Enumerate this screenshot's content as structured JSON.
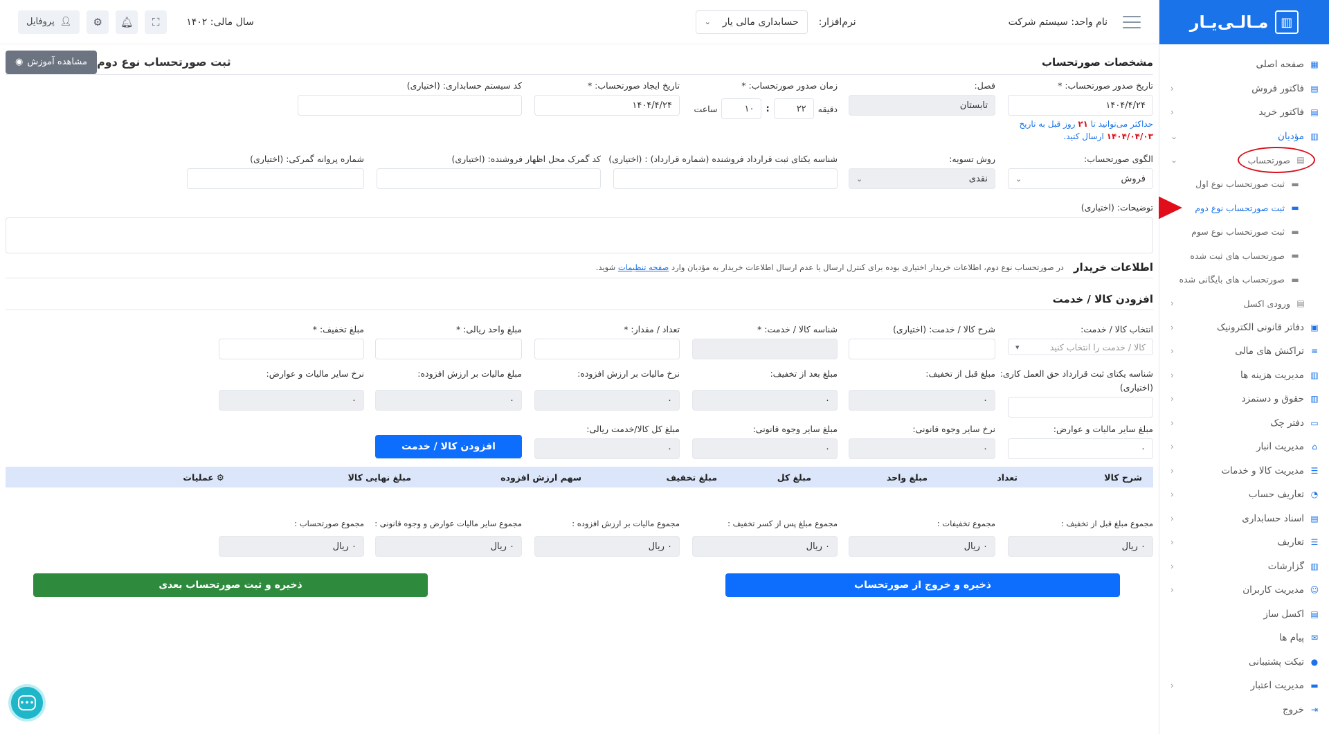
{
  "topbar": {
    "unit_label": "نام واحد: سیستم شرکت",
    "software_label": "نرم‌افزار:",
    "software_value": "حسابداری مالی یار",
    "fiscal_year": "سال مالی: ۱۴۰۲",
    "profile": "پروفایل"
  },
  "logo": {
    "text": "مـالـی‌یـار"
  },
  "sidebar": {
    "items": [
      {
        "label": "صفحه اصلی",
        "icon": "grid-icon"
      },
      {
        "label": "فاکتور فروش",
        "icon": "doc-icon"
      },
      {
        "label": "فاکتور خرید",
        "icon": "doc-icon"
      },
      {
        "label": "مؤدیان",
        "icon": "chart-icon"
      },
      {
        "label": "صورتحساب",
        "icon": "doc-icon"
      },
      {
        "label": "ثبت صورتحساب نوع اول",
        "icon": "card-icon"
      },
      {
        "label": "ثبت صورتحساب نوع دوم",
        "icon": "card-icon"
      },
      {
        "label": "ثبت صورتحساب نوع سوم",
        "icon": "card-icon"
      },
      {
        "label": "صورتحساب های ثبت شده",
        "icon": "card-icon"
      },
      {
        "label": "صورتحساب های بایگانی شده",
        "icon": "card-icon"
      },
      {
        "label": "ورودی اکسل",
        "icon": "doc-icon"
      },
      {
        "label": "دفاتر قانونی الکترونیک",
        "icon": "book-icon"
      },
      {
        "label": "تراکنش های مالی",
        "icon": "stack-icon"
      },
      {
        "label": "مدیریت هزینه ها",
        "icon": "chart-icon"
      },
      {
        "label": "حقوق و دستمزد",
        "icon": "chart-icon"
      },
      {
        "label": "دفتر چک",
        "icon": "money-icon"
      },
      {
        "label": "مدیریت انبار",
        "icon": "warehouse-icon"
      },
      {
        "label": "مدیریت کالا و خدمات",
        "icon": "list-icon"
      },
      {
        "label": "تعاریف حساب",
        "icon": "pie-icon"
      },
      {
        "label": "اسناد حسابداری",
        "icon": "doc-icon"
      },
      {
        "label": "تعاریف",
        "icon": "list-icon"
      },
      {
        "label": "گزارشات",
        "icon": "chart-icon"
      },
      {
        "label": "مدیریت کاربران",
        "icon": "users-icon"
      },
      {
        "label": "اکسل ساز",
        "icon": "doc-icon"
      },
      {
        "label": "پیام ها",
        "icon": "mail-icon"
      },
      {
        "label": "تیکت پشتیبانی",
        "icon": "chat-icon"
      },
      {
        "label": "مدیریت اعتبار",
        "icon": "card-icon"
      },
      {
        "label": "خروج",
        "icon": "exit-icon"
      }
    ]
  },
  "header": {
    "section_title": "مشخصات صورتحساب",
    "page_title": "ثبت صورتحساب نوع دوم",
    "tutorial_button": "مشاهده آموزش"
  },
  "form1": {
    "issue_date_label": "تاریخ صدور صورتحساب: *",
    "issue_date_value": "۱۴۰۴/۴/۲۴",
    "season_label": "فصل:",
    "season_value": "تابستان",
    "issue_time_label": "زمان صدور صورتحساب: *",
    "minute_label": "دقیقه",
    "minute_value": "۲۲",
    "hour_label": "ساعت",
    "hour_value": "۱۰",
    "create_date_label": "تاریخ ایجاد صورتحساب: *",
    "create_date_value": "۱۴۰۴/۴/۲۴",
    "acc_code_label": "کد سیستم حسابداری: (اختیاری)",
    "hint_line1_a": "حداکثر می‌توانید تا",
    "hint_days": "۲۱",
    "hint_line1_b": "روز قبل به تاریخ",
    "hint_date": "۱۴۰۴/۰۴/۰۳",
    "hint_line2": "ارسال کنید."
  },
  "form2": {
    "pattern_label": "الگوی صورتحساب:",
    "pattern_value": "فروش",
    "settle_label": "روش تسویه:",
    "settle_value": "نقدی",
    "contract_label": "شناسه یکتای ثبت قرارداد فروشنده (شماره قرارداد) : (اختیاری)",
    "customs_label": "کد گمرک محل اظهار فروشنده: (اختیاری)",
    "license_label": "شماره پروانه گمرکی: (اختیاری)",
    "desc_label": "توضیحات: (اختیاری)"
  },
  "buyer": {
    "title": "اطلاعات خریدار",
    "note_a": "در صورتحساب نوع دوم، اطلاعات خریدار اختیاری بوده برای کنترل ارسال یا عدم ارسال اطلاعات خریدار به مؤدیان وارد",
    "note_link": "صفحه تنظیمات",
    "note_b": "شوید."
  },
  "goods": {
    "title": "افزودن کالا / خدمت",
    "select_label": "انتخاب کالا / خدمت:",
    "select_placeholder": "کالا / خدمت را انتخاب کنید",
    "desc_label": "شرح کالا / خدمت: (اختیاری)",
    "id_label": "شناسه کالا / خدمت: *",
    "qty_label": "تعداد / مقدار: *",
    "unit_price_label": "مبلغ واحد ریالی: *",
    "discount_label": "مبلغ تخفیف: *",
    "work_contract_label": "شناسه یکتای ثبت قرارداد حق العمل کاری:",
    "work_contract_opt": "(اختیاری)",
    "before_disc_label": "مبلغ قبل از تخفیف:",
    "after_disc_label": "مبلغ بعد از تخفیف:",
    "vat_rate_label": "نرخ مالیات بر ارزش افزوده:",
    "vat_amount_label": "مبلغ مالیات بر ارزش افزوده:",
    "other_tax_rate_label": "نرخ سایر مالیات و عوارض:",
    "other_tax_amount_label": "مبلغ سایر مالیات و عوارض:",
    "other_legal_rate_label": "نرخ سایر وجوه قانونی:",
    "other_legal_amount_label": "مبلغ سایر وجوه قانونی:",
    "total_label": "مبلغ کل کالا/خدمت ریالی:",
    "zero": "۰",
    "add_button": "افزودن کالا / خدمت"
  },
  "table": {
    "headers": [
      "شرح کالا",
      "تعداد",
      "مبلغ واحد",
      "مبلغ کل",
      "مبلغ تخفیف",
      "سهم ارزش افزوده",
      "مبلغ نهایی کالا",
      "عملیات"
    ]
  },
  "totals": {
    "before_disc_label": "مجموع مبلغ قبل از تخفیف :",
    "discounts_label": "مجموع تخفیفات :",
    "after_disc_label": "مجموع مبلغ پس از کسر تخفیف :",
    "vat_label": "مجموع مالیات بر ارزش افزوده :",
    "other_label": "مجموع سایر مالیات عوارض و وجوه قانونی :",
    "invoice_label": "مجموع صورتحساب :",
    "value": "۰ ریال"
  },
  "actions": {
    "save_exit": "ذخیره و خروج از صورتحساب",
    "save_next": "ذخیره و ثبت صورتحساب بعدی"
  },
  "colors": {
    "primary": "#1a73e8",
    "button_blue": "#0d6efd",
    "button_green": "#2e8b3e",
    "annotation_red": "#d8101c"
  }
}
